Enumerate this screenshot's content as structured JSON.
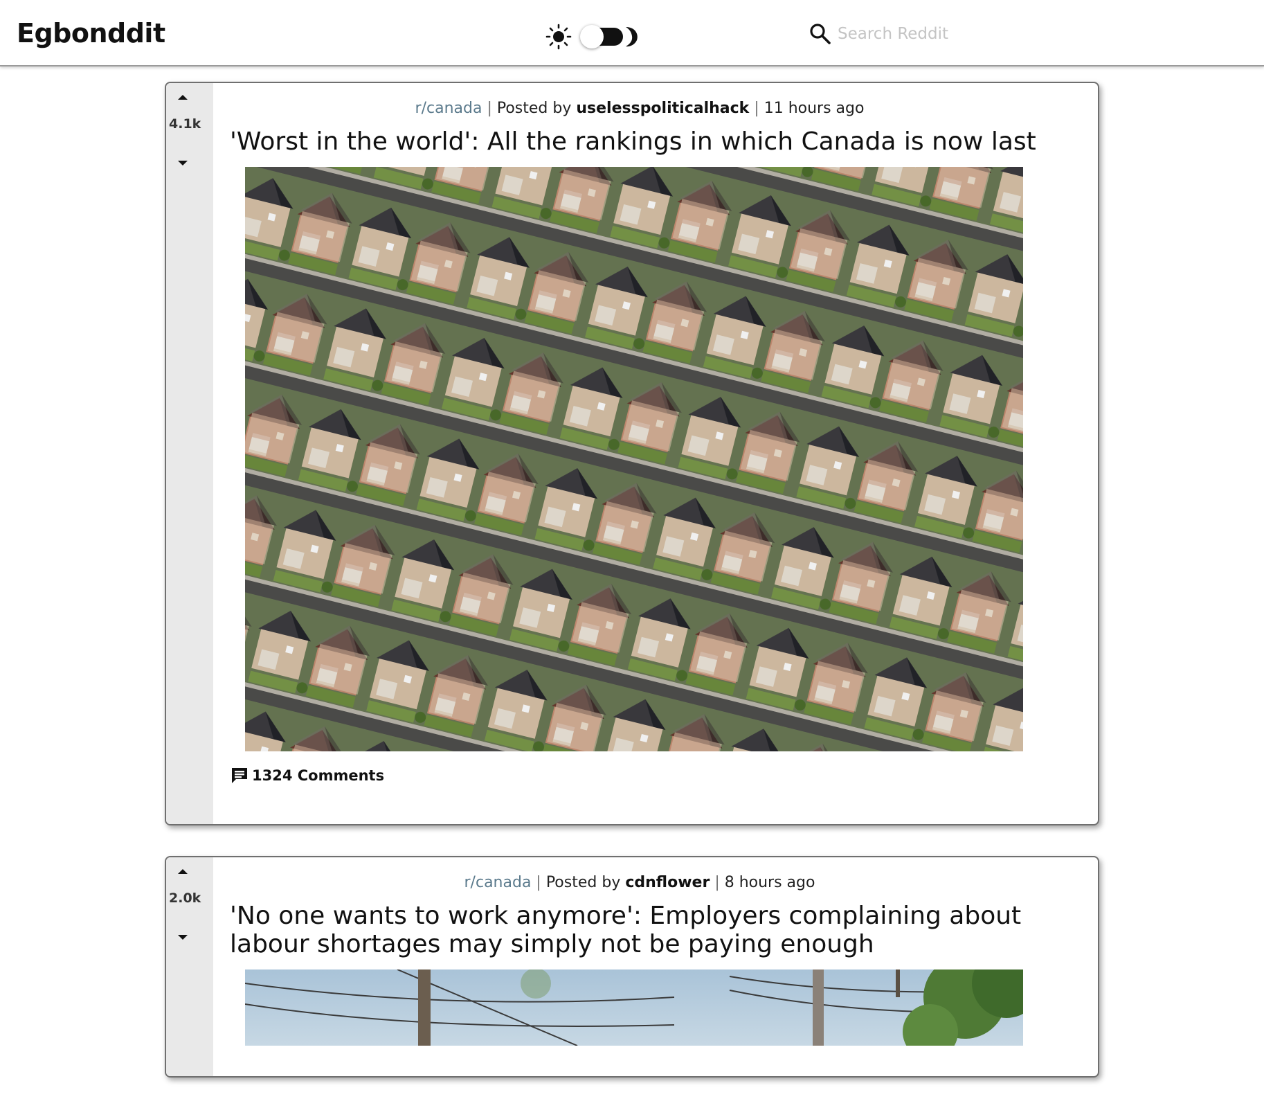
{
  "app": {
    "title": "Egbonddit"
  },
  "search": {
    "placeholder": "Search Reddit",
    "value": ""
  },
  "theme": {
    "mode": "dark-toggle",
    "sun_icon": "sun-icon",
    "moon_icon": "moon-icon"
  },
  "posts": [
    {
      "votes": "4.1k",
      "subreddit": "r/canada",
      "posted_by_prefix": "Posted by",
      "author": "uselesspoliticalhack",
      "time": "11 hours ago",
      "title": "'Worst in the world': All the rankings in which Canada is now last",
      "comments": "1324 Comments",
      "image": "aerial-suburban-houses"
    },
    {
      "votes": "2.0k",
      "subreddit": "r/canada",
      "posted_by_prefix": "Posted by",
      "author": "cdnflower",
      "time": "8 hours ago",
      "title": "'No one wants to work anymore': Employers complaining about labour shortages may simply not be paying enough",
      "image": "utility-poles-sky-trees"
    }
  ],
  "colors": {
    "vote_column": "#e9e9e9",
    "subreddit": "#5b7a8c",
    "placeholder": "#c4c4c4",
    "border": "#6f6f6f"
  }
}
